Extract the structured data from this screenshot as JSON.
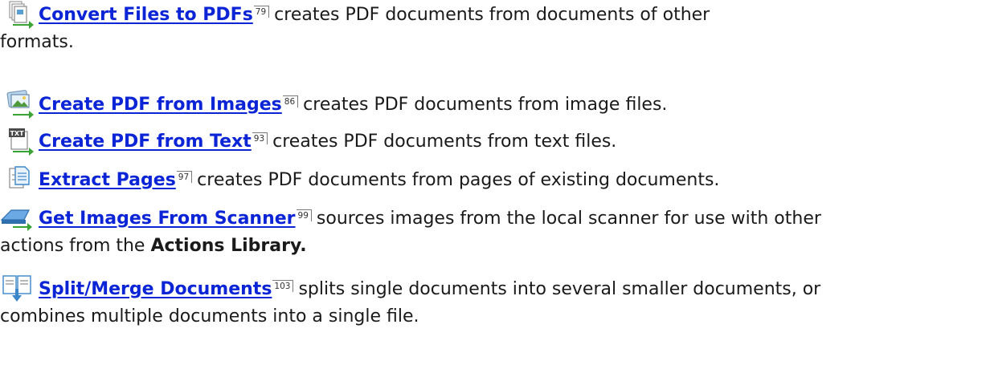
{
  "entries": [
    {
      "icon": "convert-files-icon",
      "link": "Convert Files to PDFs",
      "page": "79",
      "desc1": "creates PDF documents from documents of other",
      "desc2": "formats."
    },
    {
      "icon": "create-from-images-icon",
      "link": "Create PDF from Images",
      "page": "86",
      "desc1": "creates PDF documents from image files."
    },
    {
      "icon": "create-from-text-icon",
      "link": "Create PDF from Text",
      "page": "93",
      "desc1": "creates PDF documents from text files."
    },
    {
      "icon": "extract-pages-icon",
      "link": "Extract Pages",
      "page": "97",
      "desc1": "creates PDF documents from pages of existing documents."
    },
    {
      "icon": "scanner-icon",
      "link": "Get Images From Scanner",
      "page": "99",
      "desc1": "sources images from the local scanner for use with other",
      "desc2_prefix": "actions from the",
      "desc2_bold": "Actions Library."
    },
    {
      "icon": "split-merge-icon",
      "link": "Split/Merge Documents",
      "page": "103",
      "desc1": "splits single documents into several smaller documents, or",
      "desc2": "combines multiple documents into a single file."
    }
  ],
  "colors": {
    "link": "#0b24d6",
    "text": "#1a1a1a",
    "arrow": "#3aa335"
  },
  "icon_glyph_text": "TXT"
}
